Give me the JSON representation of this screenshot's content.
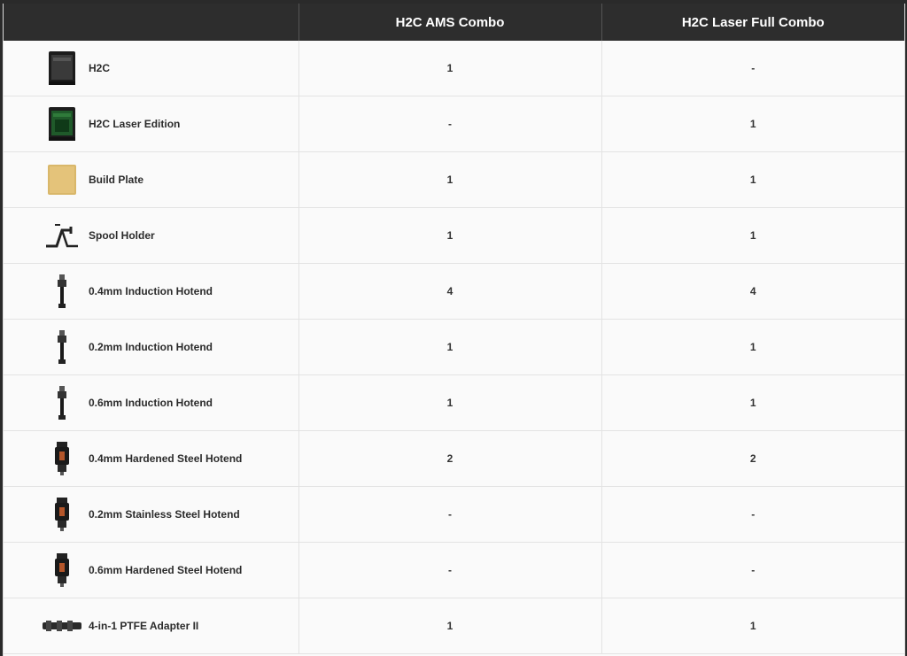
{
  "header": {
    "col1": "",
    "col2": "H2C AMS Combo",
    "col3": "H2C Laser Full Combo"
  },
  "rows": [
    {
      "name": "H2C",
      "icon": "printer-icon",
      "ams": "1",
      "laser": "-"
    },
    {
      "name": "H2C Laser Edition",
      "icon": "laser-printer-icon",
      "ams": "-",
      "laser": "1"
    },
    {
      "name": "Build Plate",
      "icon": "build-plate-icon",
      "ams": "1",
      "laser": "1"
    },
    {
      "name": "Spool Holder",
      "icon": "spool-holder-icon",
      "ams": "1",
      "laser": "1"
    },
    {
      "name": "0.4mm Induction Hotend",
      "icon": "induction-hotend-icon",
      "ams": "4",
      "laser": "4"
    },
    {
      "name": "0.2mm Induction Hotend",
      "icon": "induction-hotend-icon",
      "ams": "1",
      "laser": "1"
    },
    {
      "name": "0.6mm Induction Hotend",
      "icon": "induction-hotend-icon",
      "ams": "1",
      "laser": "1"
    },
    {
      "name": "0.4mm Hardened Steel Hotend",
      "icon": "steel-hotend-icon",
      "ams": "2",
      "laser": "2"
    },
    {
      "name": "0.2mm Stainless Steel Hotend",
      "icon": "steel-hotend-icon",
      "ams": "-",
      "laser": "-"
    },
    {
      "name": "0.6mm Hardened Steel Hotend",
      "icon": "steel-hotend-icon",
      "ams": "-",
      "laser": "-"
    },
    {
      "name": "4-in-1 PTFE Adapter II",
      "icon": "ptfe-adapter-icon",
      "ams": "1",
      "laser": "1"
    }
  ],
  "colors": {
    "header_bg": "#2d2d2d",
    "row_bg": "#fafafa",
    "border": "#e3e3e3"
  }
}
